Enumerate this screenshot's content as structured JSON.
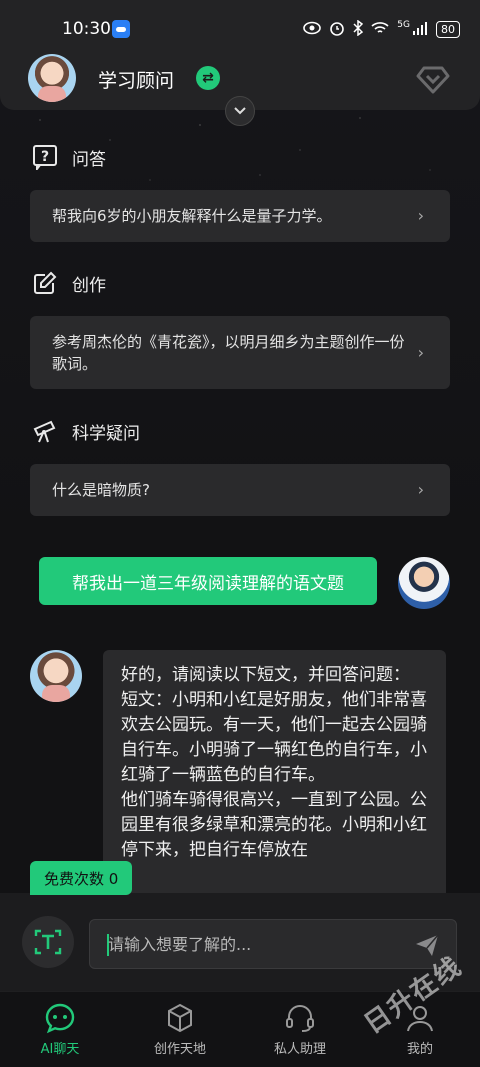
{
  "status_bar": {
    "time": "10:30",
    "network_label": "5G",
    "battery": "80"
  },
  "header": {
    "title": "学习顾问"
  },
  "sections": [
    {
      "title": "问答",
      "icon": "question-icon",
      "prompt": "帮我向6岁的小朋友解释什么是量子力学。"
    },
    {
      "title": "创作",
      "icon": "edit-icon",
      "prompt": "参考周杰伦的《青花瓷》，以明月细乡为主题创作一份歌词。"
    },
    {
      "title": "科学疑问",
      "icon": "telescope-icon",
      "prompt": "什么是暗物质?"
    }
  ],
  "chat": {
    "user_message": "帮我出一道三年级阅读理解的语文题",
    "bot_message": "好的，请阅读以下短文，并回答问题：\n短文：小明和小红是好朋友，他们非常喜欢去公园玩。有一天，他们一起去公园骑自行车。小明骑了一辆红色的自行车，小红骑了一辆蓝色的自行车。\n他们骑车骑得很高兴，一直到了公园。公园里有很多绿草和漂亮的花。小明和小红停下来，把自行车停放在"
  },
  "free_count": {
    "label": "免费次数 0"
  },
  "input": {
    "placeholder": "请输入想要了解的..."
  },
  "nav": [
    {
      "label": "AI聊天",
      "icon": "chat-icon",
      "active": true
    },
    {
      "label": "创作天地",
      "icon": "cube-icon",
      "active": false
    },
    {
      "label": "私人助理",
      "icon": "headset-icon",
      "active": false
    },
    {
      "label": "我的",
      "icon": "profile-icon",
      "active": false
    }
  ],
  "watermark": "日升在线",
  "colors": {
    "accent": "#22c97a",
    "background": "#121214",
    "card": "#2a2a2c"
  }
}
